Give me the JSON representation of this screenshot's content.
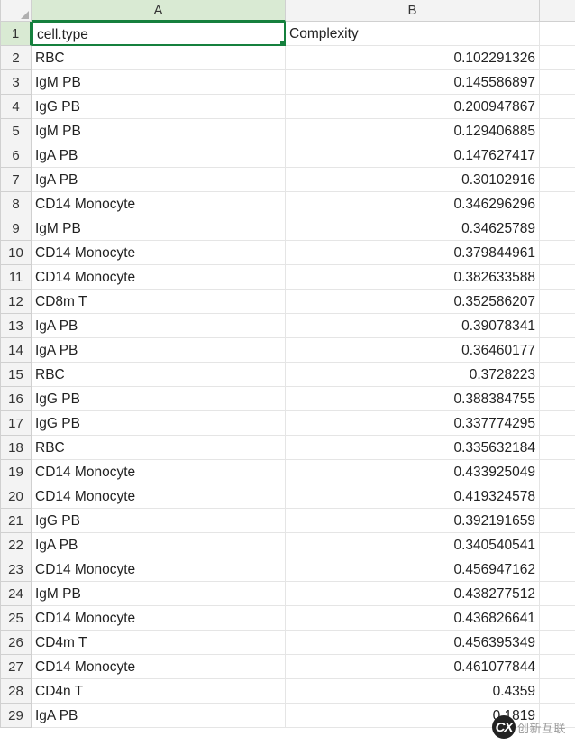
{
  "columns": [
    "A",
    "B"
  ],
  "selected_cell": {
    "row": 1,
    "col": 0
  },
  "rows": [
    {
      "n": 1,
      "a": "cell.type",
      "b": "Complexity"
    },
    {
      "n": 2,
      "a": "RBC",
      "b": "0.102291326"
    },
    {
      "n": 3,
      "a": "IgM PB",
      "b": "0.145586897"
    },
    {
      "n": 4,
      "a": "IgG PB",
      "b": "0.200947867"
    },
    {
      "n": 5,
      "a": "IgM PB",
      "b": "0.129406885"
    },
    {
      "n": 6,
      "a": "IgA PB",
      "b": "0.147627417"
    },
    {
      "n": 7,
      "a": "IgA PB",
      "b": "0.30102916"
    },
    {
      "n": 8,
      "a": "CD14 Monocyte",
      "b": "0.346296296"
    },
    {
      "n": 9,
      "a": "IgM PB",
      "b": "0.34625789"
    },
    {
      "n": 10,
      "a": "CD14 Monocyte",
      "b": "0.379844961"
    },
    {
      "n": 11,
      "a": "CD14 Monocyte",
      "b": "0.382633588"
    },
    {
      "n": 12,
      "a": "CD8m T",
      "b": "0.352586207"
    },
    {
      "n": 13,
      "a": "IgA PB",
      "b": "0.39078341"
    },
    {
      "n": 14,
      "a": "IgA PB",
      "b": "0.36460177"
    },
    {
      "n": 15,
      "a": "RBC",
      "b": "0.3728223"
    },
    {
      "n": 16,
      "a": "IgG PB",
      "b": "0.388384755"
    },
    {
      "n": 17,
      "a": "IgG PB",
      "b": "0.337774295"
    },
    {
      "n": 18,
      "a": "RBC",
      "b": "0.335632184"
    },
    {
      "n": 19,
      "a": "CD14 Monocyte",
      "b": "0.433925049"
    },
    {
      "n": 20,
      "a": "CD14 Monocyte",
      "b": "0.419324578"
    },
    {
      "n": 21,
      "a": "IgG PB",
      "b": "0.392191659"
    },
    {
      "n": 22,
      "a": "IgA PB",
      "b": "0.340540541"
    },
    {
      "n": 23,
      "a": "CD14 Monocyte",
      "b": "0.456947162"
    },
    {
      "n": 24,
      "a": "IgM PB",
      "b": "0.438277512"
    },
    {
      "n": 25,
      "a": "CD14 Monocyte",
      "b": "0.436826641"
    },
    {
      "n": 26,
      "a": "CD4m T",
      "b": "0.456395349"
    },
    {
      "n": 27,
      "a": "CD14 Monocyte",
      "b": "0.461077844"
    },
    {
      "n": 28,
      "a": "CD4n T",
      "b": "0.4359"
    },
    {
      "n": 29,
      "a": "IgA PB",
      "b": "0.1819"
    }
  ],
  "watermark": {
    "text": "创新互联",
    "logo_text": "CX"
  }
}
